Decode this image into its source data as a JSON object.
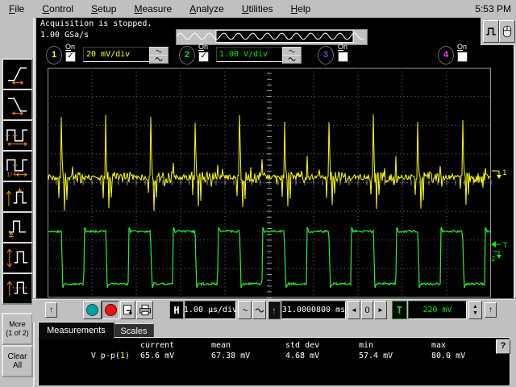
{
  "menu": {
    "items": [
      {
        "label": "File"
      },
      {
        "label": "Control"
      },
      {
        "label": "Setup"
      },
      {
        "label": "Measure"
      },
      {
        "label": "Analyze"
      },
      {
        "label": "Utilities"
      },
      {
        "label": "Help"
      }
    ],
    "clock": "5:53 PM"
  },
  "status": {
    "line1": "Acquisition is stopped.",
    "line2": "1.00 GSa/s"
  },
  "channels": {
    "ch1": {
      "num": "1",
      "on_label": "On",
      "checked": "✓",
      "scale": "20 mV/div",
      "color": "#ffff00"
    },
    "ch2": {
      "num": "2",
      "on_label": "On",
      "checked": "✓",
      "scale": "1.00 V/div",
      "color": "#00ee00"
    },
    "ch3": {
      "num": "3",
      "on_label": "On",
      "color": "#5050ff"
    },
    "ch4": {
      "num": "4",
      "on_label": "On",
      "color": "#ff40ff"
    }
  },
  "horizontal": {
    "label": "H",
    "scale": "1.00 µs/div",
    "delay": "31.0000800 ms",
    "zero": "0"
  },
  "trigger": {
    "label": "T",
    "level": "220 mV"
  },
  "sidebar": {
    "icons": [
      "rise-time",
      "fall-time",
      "period",
      "duty-cycle",
      "v-top",
      "v-base",
      "v-p-p",
      "v-avg"
    ],
    "more_line1": "More",
    "more_line2": "(1 of 2)",
    "clear_line1": "Clear",
    "clear_line2": "All"
  },
  "measurements": {
    "tabs": [
      {
        "label": "Measurements"
      },
      {
        "label": "Scales"
      }
    ],
    "columns": {
      "current": "current",
      "mean": "mean",
      "std": "std dev",
      "min": "min",
      "max": "max"
    },
    "row": {
      "prefix": "V p-p(",
      "chan": "1",
      "suffix": ")",
      "current": "65.6 mV",
      "mean": "67.38 mV",
      "std": "4.68 mV",
      "min": "57.4 mV",
      "max": "80.0 mV"
    },
    "help": "?"
  },
  "display": {
    "grid_color": "#787878",
    "ch1_color": "#ffff00",
    "ch2_color": "#2aee2a",
    "marker_t": "T",
    "marker_1": "1",
    "marker_2": "2"
  }
}
